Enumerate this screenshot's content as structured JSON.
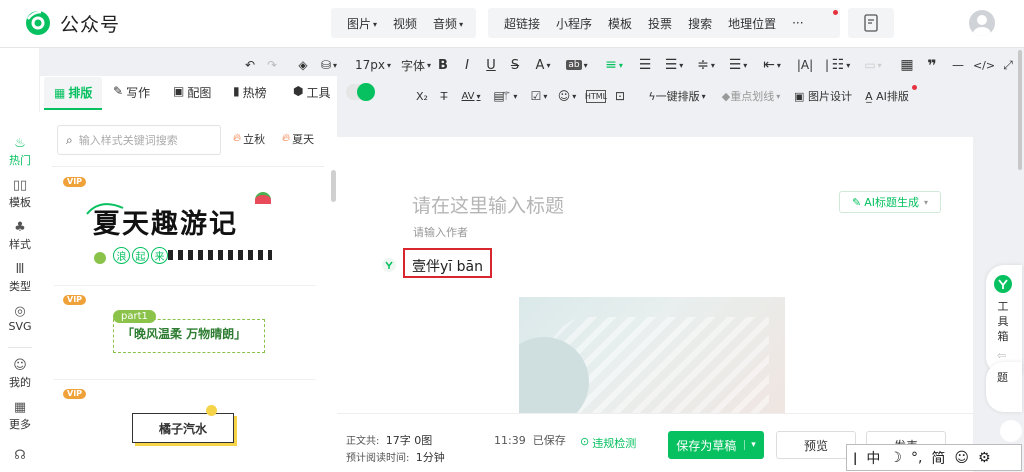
{
  "app": {
    "name": "公众号"
  },
  "top_menu": {
    "group1": [
      {
        "label": "图片",
        "caret": true
      },
      {
        "label": "视频",
        "caret": false
      },
      {
        "label": "音频",
        "caret": true
      }
    ],
    "group2": [
      {
        "label": "超链接"
      },
      {
        "label": "小程序"
      },
      {
        "label": "模板"
      },
      {
        "label": "投票"
      },
      {
        "label": "搜索"
      },
      {
        "label": "地理位置"
      },
      {
        "label": "···"
      }
    ]
  },
  "toolbar": {
    "font_size": "17px",
    "font_family": "字体",
    "one_click_layout": "一键排版",
    "highlight": "重点划线",
    "image_design": "图片设计",
    "ai_layout": "AI排版"
  },
  "plugin_tabs": [
    {
      "label": "排版"
    },
    {
      "label": "写作"
    },
    {
      "label": "配图"
    },
    {
      "label": "热榜"
    },
    {
      "label": "工具"
    }
  ],
  "left_rail": [
    {
      "label": "热门"
    },
    {
      "label": "模板"
    },
    {
      "label": "样式"
    },
    {
      "label": "类型"
    },
    {
      "label": "SVG"
    },
    {
      "label": "我的"
    },
    {
      "label": "更多"
    }
  ],
  "search": {
    "placeholder": "输入样式关键词搜索"
  },
  "hot_tags": [
    {
      "label": "立秋"
    },
    {
      "label": "夏天"
    }
  ],
  "templates": [
    {
      "vip": "VIP",
      "title": "夏天趣游记",
      "sub": [
        "浪",
        "起",
        "来"
      ]
    },
    {
      "vip": "VIP",
      "tag": "part1",
      "title": "「晚风温柔 万物晴朗」"
    },
    {
      "vip": "VIP",
      "title": "橘子汽水"
    }
  ],
  "editor": {
    "title_placeholder": "请在这里输入标题",
    "ai_title_btn": "AI标题生成",
    "author_placeholder": "请输入作者",
    "body_text": "壹伴yī bān"
  },
  "footer": {
    "word_count_label": "正文共:",
    "word_count": "17字 0图",
    "read_time_label": "预计阅读时间:",
    "read_time": "1分钟",
    "saved_time": "11:39",
    "saved_label": "已保存",
    "check_label": "违规检测",
    "save_draft": "保存为草稿",
    "preview": "预览",
    "publish": "发表"
  },
  "side_tool": {
    "label": "工具箱",
    "label_chars": [
      "工",
      "具",
      "箱"
    ],
    "topic": "题"
  },
  "ime": {
    "items": [
      "中",
      "☽",
      "°,",
      "简",
      "☺",
      "⚙"
    ]
  },
  "colors": {
    "brand": "#07c160",
    "accent_red": "#e5323e",
    "vip": "#f0a23a"
  }
}
